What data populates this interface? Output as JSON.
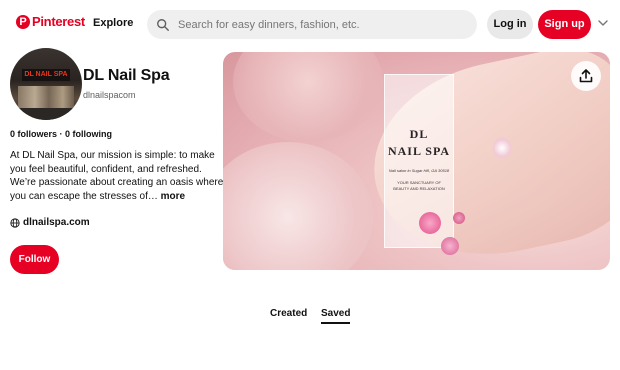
{
  "header": {
    "logo_text": "Pinterest",
    "explore_label": "Explore",
    "search_placeholder": "Search for easy dinners, fashion, etc.",
    "login_label": "Log in",
    "signup_label": "Sign up",
    "brand_color": "#e60023"
  },
  "profile": {
    "avatar_sign_text": "DL NAIL SPA",
    "name": "DL Nail Spa",
    "handle": "dlnailspacom",
    "followers": "0 followers",
    "separator": " · ",
    "following": "0 following",
    "bio": "At DL Nail Spa, our mission is simple: to make you feel beautiful, confident, and refreshed. We’re passionate about creating an oasis where you can escape the stresses of…",
    "more_label": "more",
    "website": "dlnailspa.com",
    "follow_label": "Follow"
  },
  "cover": {
    "card_title_1": "DL",
    "card_title_2": "NAIL SPA",
    "card_subtitle": "Nail salon in Sugar Hill, GA 30518",
    "card_tagline": "YOUR SANCTUARY OF BEAUTY AND RELAXATION"
  },
  "tabs": {
    "created": "Created",
    "saved": "Saved"
  },
  "icons": {
    "search": "search-icon",
    "chevron": "chevron-down-icon",
    "globe": "globe-icon",
    "share": "share-upload-icon"
  }
}
